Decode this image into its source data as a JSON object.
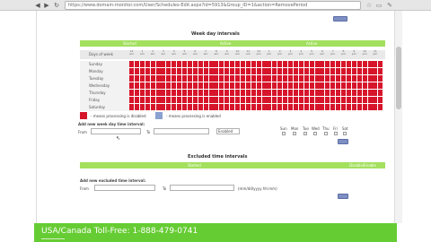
{
  "browser": {
    "url": "https://www.domain-monitor.com/User/Schedules-Edit.aspx?id=5913&Group_ID=1&action=RemovePeriod"
  },
  "weekday": {
    "title": "Week day intervals",
    "bar_labels": [
      "Started",
      "Active",
      "Active"
    ],
    "days_of_week_header": "Days of week",
    "hours": [
      "12 am",
      "1 am",
      "2 am",
      "3 am",
      "4 am",
      "5 am",
      "6 am",
      "7 am",
      "8 am",
      "9 am",
      "10 am",
      "11 am",
      "12 pm",
      "1 pm",
      "2 pm",
      "3 pm",
      "4 pm",
      "5 pm",
      "6 pm",
      "7 pm",
      "8 pm",
      "9 pm",
      "10 pm",
      "11 pm"
    ],
    "days": [
      "Sunday",
      "Monday",
      "Tuesday",
      "Wednesday",
      "Thursday",
      "Friday",
      "Saturday"
    ],
    "legend": {
      "disabled_text": "- means processing is disabled",
      "enabled_text": "- means processing is enabled",
      "disabled_color": "#d6152b",
      "enabled_color": "#8aa0d0"
    },
    "add_form": {
      "title": "Add new week day time interval:",
      "from_label": "From",
      "to_label": "To",
      "status_value": "Enabled",
      "dow_labels": [
        "Sun",
        "Mon",
        "Tue",
        "Wed",
        "Thu",
        "Fri",
        "Sat"
      ]
    }
  },
  "excluded": {
    "title": "Excluded time intervals",
    "bar_labels": [
      "Started",
      "Disable/Enable"
    ],
    "add_title": "Add new excluded time interval:",
    "from_label": "From",
    "to_label": "To",
    "date_hint": "(mm/dd/yyyy hh:mm)"
  },
  "banner": {
    "text": "USA/Canada Toll-Free: 1-888-479-0741"
  },
  "colors": {
    "accent_green": "#a3e05e",
    "banner_green": "#66cc33",
    "blocked_red": "#d6152b",
    "button_blue": "#7f8fc2"
  }
}
